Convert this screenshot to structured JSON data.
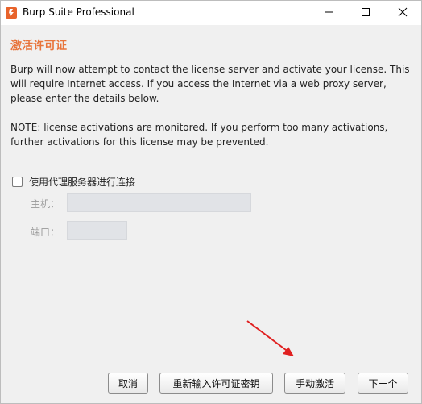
{
  "window": {
    "title": "Burp Suite Professional",
    "icon": "burp-logo-icon",
    "controls": [
      "minimize-icon",
      "maximize-icon",
      "close-icon"
    ]
  },
  "heading": "激活许可证",
  "paragraphs": {
    "intro": "Burp will now attempt to contact the license server and activate your license. This will require Internet access. If you access the Internet via a web proxy server, please enter the details below.",
    "note": "NOTE: license activations are monitored. If you perform too many activations, further activations for this license may be prevented."
  },
  "proxy": {
    "checkbox_label": "使用代理服务器进行连接",
    "checked": false,
    "host_label": "主机：",
    "host_value": "",
    "port_label": "端口：",
    "port_value": ""
  },
  "buttons": {
    "cancel": "取消",
    "reenter": "重新输入许可证密钥",
    "manual": "手动激活",
    "next": "下一个"
  },
  "annotation": {
    "arrow_color": "#e02020",
    "points_to": "manual-activation-button"
  },
  "colors": {
    "heading": "#e8743b",
    "brand": "#ff6633"
  }
}
